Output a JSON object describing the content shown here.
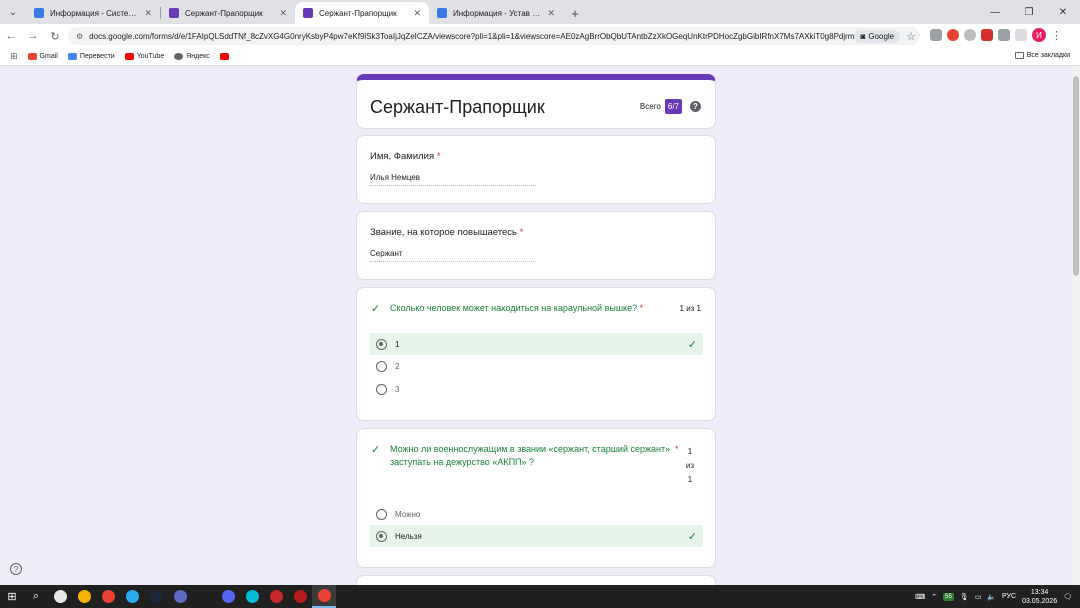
{
  "browser": {
    "tabs": [
      {
        "title": "Информация - Система повышения",
        "color": "#3b78e7",
        "active": false
      },
      {
        "title": "Сержант-Прапорщик",
        "color": "#673ab7",
        "active": false
      },
      {
        "title": "Сержант-Прапорщик",
        "color": "#673ab7",
        "active": true
      },
      {
        "title": "Информация - Устав Армии |",
        "color": "#3b78e7",
        "active": false
      }
    ],
    "url": "docs.google.com/forms/d/e/1FAIpQLSddTNf_8cZvXG4G0nryKsbyP4pw7eKf9lSk3ToaIjJqZeICZA/viewscore?pli=1&pli=1&viewscore=AE0zAgBrrObQbUTAntbZzXkOGeqUnKtrPDHocZgbGibIRfnX7Ms7AXkiT0g8PdjrmZTIx...",
    "google_chip": "Google",
    "profile_initial": "И",
    "bookmarks": [
      {
        "label": "Gmail",
        "color": "#ea4335"
      },
      {
        "label": "Перевести",
        "color": "#4285f4"
      },
      {
        "label": "YouTube",
        "color": "#ff0000"
      },
      {
        "label": "Яндекс",
        "color": "#5f6368"
      },
      {
        "label": "",
        "color": "#ff0000"
      }
    ],
    "all_bookmarks": "Все закладки"
  },
  "form": {
    "title": "Сержант-Прапорщик",
    "score_label": "Всего",
    "score": "6/7",
    "help": "?",
    "q1": {
      "label": "Имя, Фамилия",
      "req": "*",
      "answer": "Илья Немцев"
    },
    "q2": {
      "label": "Звание, на которое повышаетесь",
      "req": "*",
      "answer": "Сержант"
    },
    "q3": {
      "text": "Сколько человек может находиться на караульной вышке?",
      "req": "*",
      "points": "1 из 1",
      "options": [
        "1",
        "2",
        "3"
      ]
    },
    "q4": {
      "text": "Можно ли военнослужащим в звании «сержант, старший сержант» заступать на дежурство «АКПП» ?",
      "req": "*",
      "points_1": "1",
      "points_2": "из",
      "points_3": "1",
      "options": [
        "Можно",
        "Нельзя"
      ]
    }
  },
  "taskbar": {
    "lang": "РУС",
    "time": "13:34",
    "date": "03.05.2026",
    "badge": "55",
    "apps": [
      "#e8e8e8",
      "#f4b400",
      "#ea4335",
      "#2aabee",
      "#1b2838",
      "#5c6bc0",
      "#202020",
      "#5865f2",
      "#00bcd4",
      "#c62828",
      "#b71c1c",
      "#ea4335"
    ]
  }
}
